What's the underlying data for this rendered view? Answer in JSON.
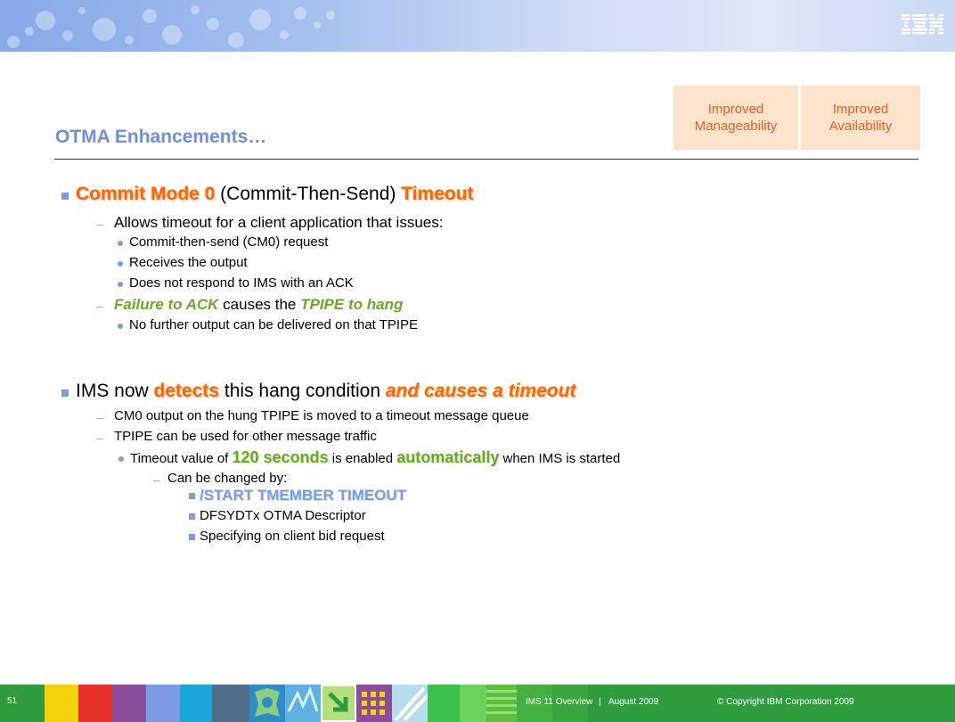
{
  "header": {
    "tags": [
      "Improved Manageability",
      "Improved Availability"
    ],
    "tag_lines": [
      [
        "Improved",
        "Manageability"
      ],
      [
        "Improved",
        "Availability"
      ]
    ],
    "title": "OTMA Enhancements…"
  },
  "section1": {
    "heading": {
      "part1": "Commit Mode 0",
      "part2": " (Commit-Then-Send) ",
      "part3": "Timeout"
    },
    "sub1": "Allows timeout for a client application that issues:",
    "sub1_items": [
      "Commit-then-send (CM0) request",
      "Receives the output",
      "Does not respond to IMS with an ACK"
    ],
    "sub2": {
      "part1": "Failure to ACK",
      "part2": " causes the ",
      "part3": "TPIPE to hang"
    },
    "sub2_items": [
      "No further output can be delivered on that TPIPE"
    ]
  },
  "section2": {
    "heading": {
      "part1": "IMS now ",
      "part2": "detects",
      "part3": " this hang condition ",
      "part4": "and causes a timeout"
    },
    "sub1": "CM0 output on the hung TPIPE is moved to a timeout message queue",
    "sub2": "TPIPE can be used for other message traffic",
    "bullet": {
      "part1": "Timeout value of ",
      "part2": "120 seconds",
      "part3": " is enabled ",
      "part4": "automatically",
      "part5": " when IMS is started"
    },
    "changed_by": "Can be changed by:",
    "options": [
      "/START TMEMBER TIMEOUT",
      "DFSYDTx OTMA Descriptor",
      "Specifying on client bid request"
    ]
  },
  "footer": {
    "page_number": "51",
    "presentation": "IMS 11 Overview",
    "date": "August 2009",
    "copyright": "© Copyright IBM Corporation 2009",
    "separator": "|"
  },
  "logo": {
    "icon": "ibm-logo",
    "text": "IBM"
  },
  "colors": {
    "accent_orange": "#ff6600",
    "accent_green": "#6aa82a",
    "accent_blue": "#7b9ce2",
    "tag_bg": "#fbe3cc",
    "footer_green": "#2e9c3c"
  }
}
